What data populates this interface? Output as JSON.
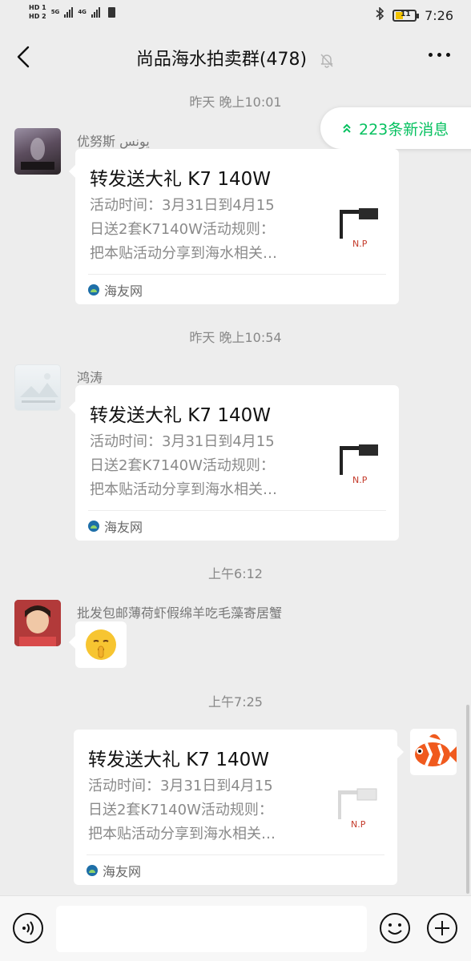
{
  "status_bar": {
    "hd1": "HD 1",
    "hd2": "HD 2",
    "net1": "5G",
    "net2": "4G",
    "battery_level": "11",
    "time": "7:26"
  },
  "header": {
    "title": "尚品海水拍卖群(478)",
    "icons": [
      "back-arrow-icon",
      "mute-bell-icon",
      "more-dots-icon"
    ]
  },
  "new_messages": {
    "label": "223条新消息",
    "icon": "double-chevron-up-icon"
  },
  "messages": [
    {
      "timestamp": "昨天 晚上10:01",
      "sender": "优努斯 یونس",
      "type": "link",
      "title": "转发送大礼 K7 140W",
      "desc": [
        "活动时间：3月31日到4月15",
        "日送2套K7140W活动规则：",
        "把本贴活动分享到海水相关…"
      ],
      "source": "海友网"
    },
    {
      "timestamp": "昨天 晚上10:54",
      "sender": "鸿涛",
      "type": "link",
      "title": "转发送大礼 K7 140W",
      "desc": [
        "活动时间：3月31日到4月15",
        "日送2套K7140W活动规则：",
        "把本贴活动分享到海水相关…"
      ],
      "source": "海友网"
    },
    {
      "timestamp": "上午6:12",
      "sender": "批发包邮薄荷虾假绵羊吃毛藻寄居蟹",
      "type": "emoji",
      "emoji": "shushing-face-emoji"
    },
    {
      "timestamp": "上午7:25",
      "sender": "",
      "type": "link",
      "title": "转发送大礼 K7 140W",
      "desc": [
        "活动时间：3月31日到4月15",
        "日送2套K7140W活动规则：",
        "把本贴活动分享到海水相关…"
      ],
      "source": "海友网"
    }
  ],
  "input_bar": {
    "placeholder": "",
    "icons": [
      "voice-icon",
      "emoji-icon",
      "plus-icon"
    ]
  },
  "colors": {
    "background": "#ededed",
    "accent": "#07c160",
    "bubble": "#ffffff"
  }
}
